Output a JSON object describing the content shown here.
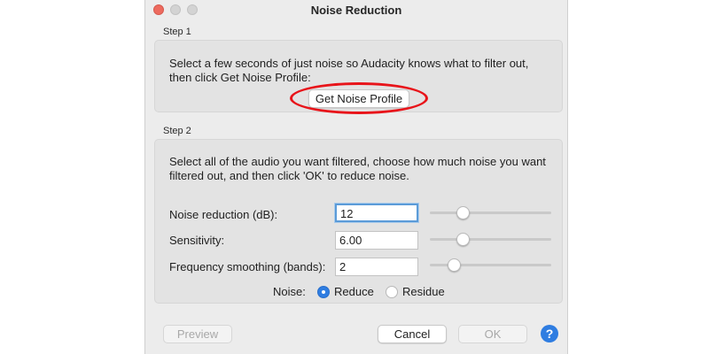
{
  "window": {
    "title": "Noise Reduction"
  },
  "step1": {
    "label": "Step 1",
    "instruction_line1": "Select a few seconds of just noise so Audacity knows what to filter out,",
    "instruction_line2": "then click Get Noise Profile:",
    "button": "Get Noise Profile"
  },
  "step2": {
    "label": "Step 2",
    "instruction_line1": "Select all of the audio you want filtered, choose how much noise you want",
    "instruction_line2": "filtered out, and then click 'OK' to reduce noise.",
    "params": [
      {
        "label": "Noise reduction (dB):",
        "value": "12",
        "slider_fraction": 0.27
      },
      {
        "label": "Sensitivity:",
        "value": "6.00",
        "slider_fraction": 0.27
      },
      {
        "label": "Frequency smoothing (bands):",
        "value": "2",
        "slider_fraction": 0.2
      }
    ],
    "noise_label": "Noise:",
    "options": [
      {
        "label": "Reduce",
        "selected": true
      },
      {
        "label": "Residue",
        "selected": false
      }
    ]
  },
  "buttons": {
    "preview": "Preview",
    "cancel": "Cancel",
    "ok": "OK",
    "help": "?"
  },
  "colors": {
    "accent": "#2f7de1",
    "highlight_annotation": "#e8141a",
    "close_button": "#ed6a5e"
  }
}
